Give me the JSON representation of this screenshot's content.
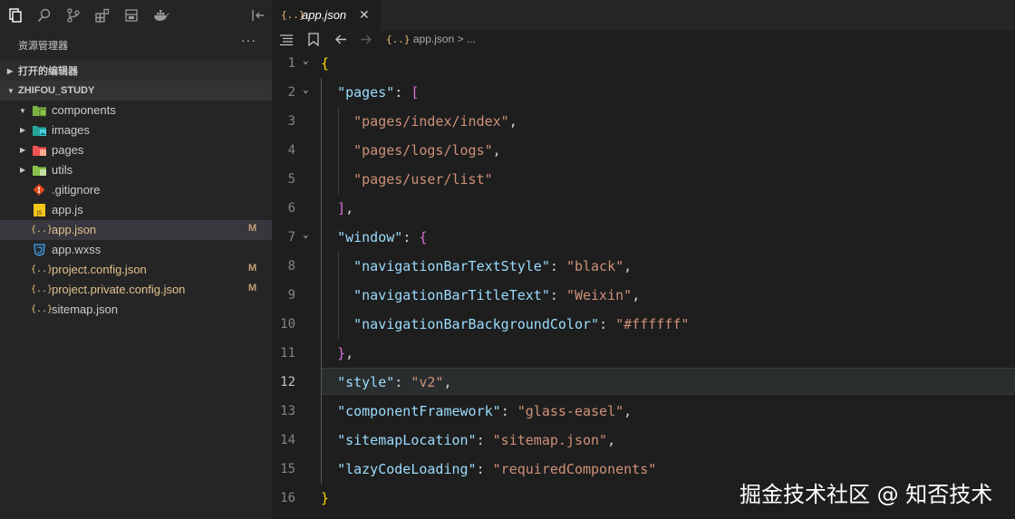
{
  "sidebar": {
    "explorer_title": "资源管理器",
    "more": "···",
    "open_editors": "打开的编辑器",
    "workspace": "ZHIFOU_STUDY",
    "items": [
      {
        "label": "components",
        "icon": "folder-components-icon",
        "type": "folder"
      },
      {
        "label": "images",
        "icon": "folder-images-icon",
        "type": "folder"
      },
      {
        "label": "pages",
        "icon": "folder-pages-icon",
        "type": "folder"
      },
      {
        "label": "utils",
        "icon": "folder-utils-icon",
        "type": "folder"
      },
      {
        "label": ".gitignore",
        "icon": "git-icon",
        "type": "file"
      },
      {
        "label": "app.js",
        "icon": "js-icon",
        "type": "file"
      },
      {
        "label": "app.json",
        "icon": "json-icon",
        "type": "file",
        "badge": "M",
        "selected": true
      },
      {
        "label": "app.wxss",
        "icon": "css-icon",
        "type": "file"
      },
      {
        "label": "project.config.json",
        "icon": "json-icon",
        "type": "file",
        "badge": "M"
      },
      {
        "label": "project.private.config.json",
        "icon": "json-icon",
        "type": "file",
        "badge": "M"
      },
      {
        "label": "sitemap.json",
        "icon": "json-icon",
        "type": "file"
      }
    ],
    "json_glyph": "{..}",
    "js_glyph": "JS",
    "css_glyph": "3"
  },
  "tab": {
    "icon": "{..}",
    "title": "app.json",
    "close": "✕"
  },
  "breadcrumb": {
    "icon": "{..}",
    "file": "app.json",
    "sep": ">",
    "rest": "..."
  },
  "editor": {
    "current_line": 12,
    "line_numbers": [
      "1",
      "2",
      "3",
      "4",
      "5",
      "6",
      "7",
      "8",
      "9",
      "10",
      "11",
      "12",
      "13",
      "14",
      "15",
      "16"
    ]
  },
  "watermark": "掘金技术社区 @ 知否技术",
  "colors": {
    "accent": "#e8c07a",
    "key": "#9cdcfe",
    "string": "#ce9178"
  }
}
